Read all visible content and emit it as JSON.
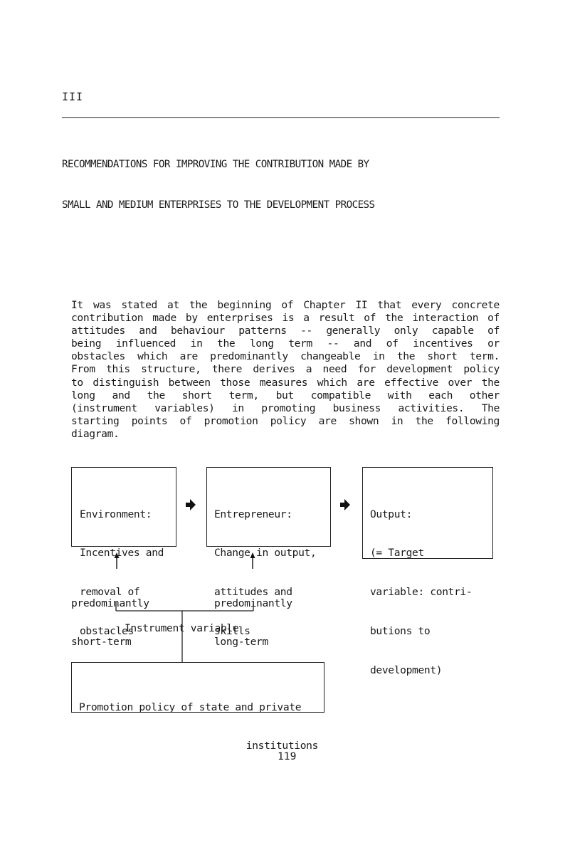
{
  "page": {
    "chapter_number": "III",
    "title_lines": [
      "RECOMMENDATIONS FOR IMPROVING THE CONTRIBUTION MADE BY",
      "SMALL AND MEDIUM ENTERPRISES TO THE DEVELOPMENT PROCESS"
    ],
    "paragraph_lines": [
      "It was stated at the beginning of Chapter II that every concrete",
      "contribution made by enterprises is a result of the interaction of",
      "attitudes and behaviour patterns -- generally only capable of",
      "being influenced in the long term -- and of incentives or",
      "obstacles which are predominantly changeable in the short term.",
      "From this structure, there derives a need for development policy",
      "to distinguish between those measures which are effective over the",
      "long and the short term, but compatible with each other",
      "(instrument variables) in promoting business activities.  The",
      "starting points of promotion policy are shown in the following",
      "diagram."
    ],
    "page_number": "119"
  },
  "diagram": {
    "environment_box": [
      "Environment:",
      "Incentives and",
      "removal of",
      "obstacles"
    ],
    "entrepreneur_box": [
      "Entrepreneur:",
      "Change in output,",
      "attitudes and",
      "skills"
    ],
    "output_box": [
      "Output:",
      "(= Target",
      "variable: contri-",
      "butions to",
      "development)"
    ],
    "short_term_label": [
      "predominantly",
      "short-term"
    ],
    "long_term_label": [
      "predominantly",
      "long-term"
    ],
    "instrument_label": "Instrument variable",
    "policy_box": [
      "Promotion policy of state and private",
      "institutions"
    ],
    "arrow_icons": [
      "right-arrow-icon",
      "right-arrow-icon",
      "up-arrow-icon",
      "up-arrow-icon"
    ]
  }
}
